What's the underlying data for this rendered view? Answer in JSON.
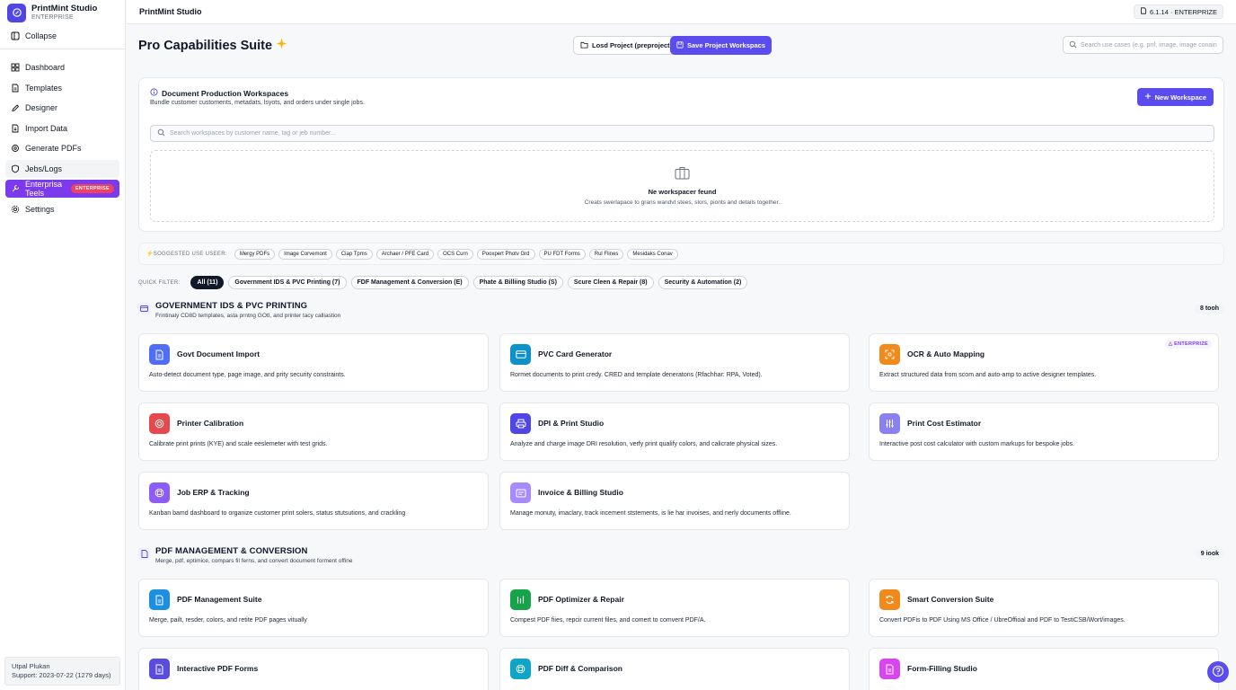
{
  "app": {
    "name": "PrintMint Studio",
    "edition": "ENTERPRISE",
    "version": "6.1.14 · ENTERPRIZE"
  },
  "sidebar": {
    "collapse_label": "Collapse",
    "items": [
      {
        "label": "Dashboard",
        "icon": "grid-icon"
      },
      {
        "label": "Templates",
        "icon": "file-icon"
      },
      {
        "label": "Designer",
        "icon": "pen-icon"
      },
      {
        "label": "Import Data",
        "icon": "import-icon"
      },
      {
        "label": "Generate PDFs",
        "icon": "gear-icon"
      },
      {
        "label": "Jebs/Logs",
        "icon": "shield-icon"
      },
      {
        "label": "Enterprisa Teels",
        "icon": "tool-icon",
        "badge": "ENTERPRISE",
        "active": true
      },
      {
        "label": "Settings",
        "icon": "settings-icon"
      }
    ],
    "user": {
      "name": "Utpal Plukan",
      "support": "Support: 2023-07-22 (1279 days)"
    }
  },
  "header": {
    "page_title": "Pro Capabilities Suite",
    "load_button": "Losd Project (preproject)",
    "save_button": "Save Project Workspacs",
    "search_placeholder": "Search use cases (e.g. pnf, image, image conain"
  },
  "workspaces": {
    "title": "Document Production Workspaces",
    "subtitle": "Bundle customer customents, metadats, lsyots, and orders under single jobs.",
    "new_button": "New Workspace",
    "search_placeholder": "Search workspaces by customer name, tag or jeb number...",
    "empty_title": "Ne workspacer feund",
    "empty_sub": "Creats swerlapace to grans wandvt stees, slors, pionts and details together."
  },
  "suggested": {
    "label": "SOGGESTED USE USEER:",
    "chips": [
      "Mergy PDFs",
      "Image Corvemont",
      "Ciap Tpms",
      "Archaer / PFE Card",
      "OCS Curn",
      "Pooxpert Photv Grd",
      "PU FDT Forms",
      "Rul Flines",
      "Mesidaks Conav"
    ]
  },
  "quick_filter": {
    "label": "QUICK FILTER:",
    "chips": [
      {
        "label": "All (11)",
        "active": true
      },
      {
        "label": "Government IDS & PVC Printing (7)"
      },
      {
        "label": "FDF Management & Conversion (E)"
      },
      {
        "label": "Phate & Billiing Studio (S)"
      },
      {
        "label": "Scure Cleen & Repair (8)"
      },
      {
        "label": "Security & Automation (2)"
      }
    ]
  },
  "sections": [
    {
      "title": "GOVERNMENT IDS & PVC PRINTING",
      "subtitle": "Frintinaly CD8D templates, asta prntng GOtI, and printer tacy calliastion",
      "count": "8 tooh",
      "cards": [
        {
          "title": "Govt Document Import",
          "desc": "Auto-detect document type, page image, and prity security constraints.",
          "icon": "document-icon",
          "color": "#4f6df5"
        },
        {
          "title": "PVC Card Generator",
          "desc": "Rormet documents to print credy. CRED and template deneratons (Rfachhar: RPA, Voted).",
          "icon": "card-icon",
          "color": "#0e90c8"
        },
        {
          "title": "OCR & Auto Mapping",
          "desc": "Extract structured data from scom and auto-amp to active designer templates.",
          "icon": "scan-icon",
          "color": "#f08a1c",
          "tag": "ENTERPRIZE"
        },
        {
          "title": "Printer Calibration",
          "desc": "Calibrate print prints (KYE) and scale eeslemeter with test grids.",
          "icon": "target-icon",
          "color": "#e5484d"
        },
        {
          "title": "DPI & Print Studio",
          "desc": "Analyze and charge image DRI resolution, verfy print qualify colors, and calicrate physical sizes.",
          "icon": "printer-icon",
          "color": "#4f46e5"
        },
        {
          "title": "Print Cost Estimator",
          "desc": "Interactive post cost calculator with custom markups for bespoke jobs.",
          "icon": "sliders-icon",
          "color": "#8b80f0"
        },
        {
          "title": "Job ERP & Tracking",
          "desc": "Kanban bamd dashboard to organize customer print solers, status stutsutions, and crackling",
          "icon": "kanban-icon",
          "color": "#8b5cf6"
        },
        {
          "title": "Invoice & Billing Studio",
          "desc": "Manage monuty, imaclary, track incement ststements, is lie har invoises, and nerly documents offline.",
          "icon": "invoice-icon",
          "color": "#a78bfa"
        }
      ]
    },
    {
      "title": "PDF MANAGEMENT & CONVERSION",
      "subtitle": "Merge, pdf, eptimice, compars fil ferns, and convert document forment offine",
      "count": "9 iook",
      "cards": [
        {
          "title": "PDF Management Suite",
          "desc": "Merge, pailt, resder, colors, and retite PDF pages vitually",
          "icon": "document-icon",
          "color": "#1d8fe0"
        },
        {
          "title": "PDF Optimizer & Repair",
          "desc": "Compest PDF fiies, repcir current files, and comert to comvent PDF/A.",
          "icon": "bars-icon",
          "color": "#16a34a"
        },
        {
          "title": "Smart Conversion Suite",
          "desc": "Convert PDFis to PDF Using MS Office / UbreOffioal and PDF to TestiCSB/Wort/images.",
          "icon": "refresh-icon",
          "color": "#f08a1c"
        },
        {
          "title": "Interactive PDF Forms",
          "desc": "",
          "icon": "form-icon",
          "color": "#5b4ce0"
        },
        {
          "title": "PDF Diff & Comparison",
          "desc": "",
          "icon": "compare-icon",
          "color": "#0ea5c9"
        },
        {
          "title": "Form-Filling Studio",
          "desc": "",
          "icon": "fill-icon",
          "color": "#d946ef"
        }
      ]
    }
  ]
}
